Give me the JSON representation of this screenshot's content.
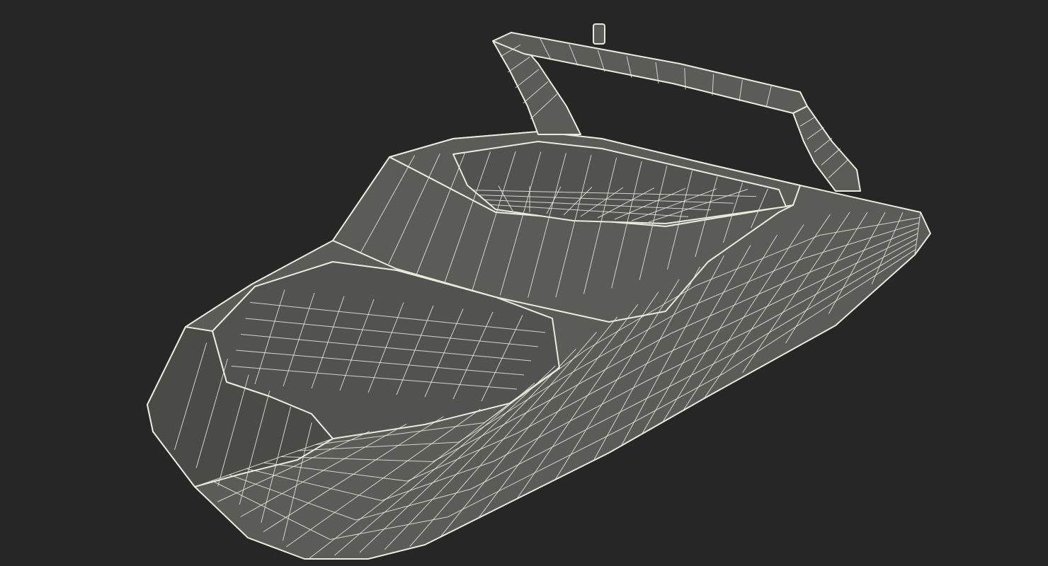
{
  "scene": {
    "background_color": "#262626",
    "surface_color": "#5b5c58",
    "surface_dark_color": "#4a4b47",
    "interior_color": "#525350",
    "wire_color": "#e9e9dc",
    "subject": "boat-wireframe-model"
  }
}
